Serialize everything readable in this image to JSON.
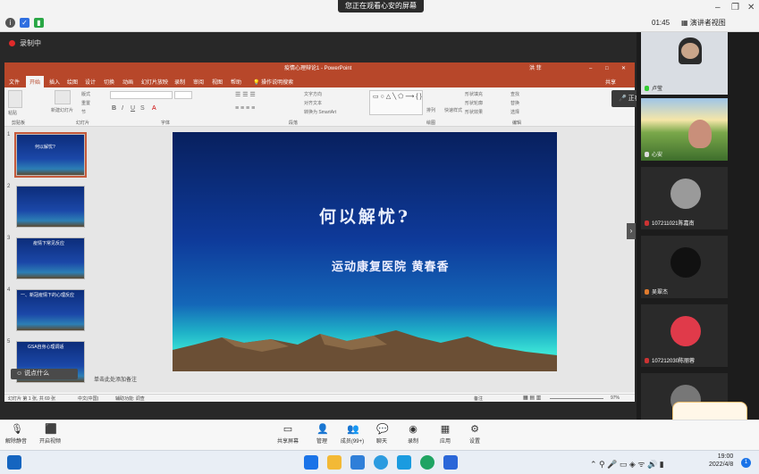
{
  "meeting": {
    "share_banner": "您正在观看心安的屏幕",
    "elapsed": "01:45",
    "view_mode": "演讲者视图",
    "recording": "录制中",
    "speaking_now": "正在讲话: 卢莹;",
    "listen_hint": "说点什么"
  },
  "ppt": {
    "window_title": "疫情心理辩论1 - PowerPoint",
    "user": "洪 菲",
    "share_label": "共享",
    "tabs": [
      "文件",
      "开始",
      "插入",
      "绘图",
      "设计",
      "切换",
      "动画",
      "幻灯片放映",
      "录制",
      "审阅",
      "视图",
      "帮助",
      "操作说明搜索"
    ],
    "active_tab": "开始",
    "ribbon_groups": [
      "剪贴板",
      "幻灯片",
      "字体",
      "段落",
      "绘图",
      "编辑"
    ],
    "ribbon_items": {
      "new_slide": "新建幻灯片",
      "layout": "版式",
      "reset": "重置",
      "section": "节",
      "reuse": "重用幻灯片",
      "text_direction": "文字方向",
      "align_text": "对齐文本",
      "convert_smartart": "转换为 SmartArt",
      "arrange": "排列",
      "quick_styles": "快速样式",
      "shape_fill": "形状填充",
      "shape_outline": "形状轮廓",
      "shape_effects": "形状效果",
      "find": "查找",
      "replace": "替换",
      "select": "选择",
      "paste": "粘贴"
    },
    "slide_numbers": [
      "1",
      "2",
      "3",
      "4",
      "5"
    ],
    "thumb_titles": [
      "何以解忧?",
      "",
      "疫情下常见反应",
      "一、新冠疫情下的心理反应",
      "GSA自身心理调适"
    ],
    "slide": {
      "title": "何以解忧?",
      "subtitle": "运动康复医院    黄春香"
    },
    "notes_placeholder": "单击此处添加备注",
    "status_left": "幻灯片 第 1 张, 共 69 张",
    "status_lang": "中文(中国)",
    "status_access": "辅助功能: 调查",
    "status_notes": "备注",
    "zoom": "97%"
  },
  "participants": [
    {
      "name": "卢莹",
      "has_video": true
    },
    {
      "name": "心安",
      "has_video": true
    },
    {
      "name": "107211021陈嘉南",
      "has_video": false
    },
    {
      "name": "吴翠杰",
      "has_video": false
    },
    {
      "name": "107212030陈丽蓉",
      "has_video": false
    },
    {
      "name": "",
      "has_video": false
    }
  ],
  "toolbar": {
    "mute": "解除静音",
    "video": "开启视频",
    "share": "共享屏幕",
    "manage": "管理",
    "members": "成员(99+)",
    "chat": "聊天",
    "record": "录制",
    "apps": "应用",
    "settings": "设置"
  },
  "taskbar": {
    "time": "19:00",
    "date": "2022/4/8",
    "notifications": "1"
  },
  "colors": {
    "ppt_accent": "#b7472a",
    "record_red": "#e02a2a"
  }
}
